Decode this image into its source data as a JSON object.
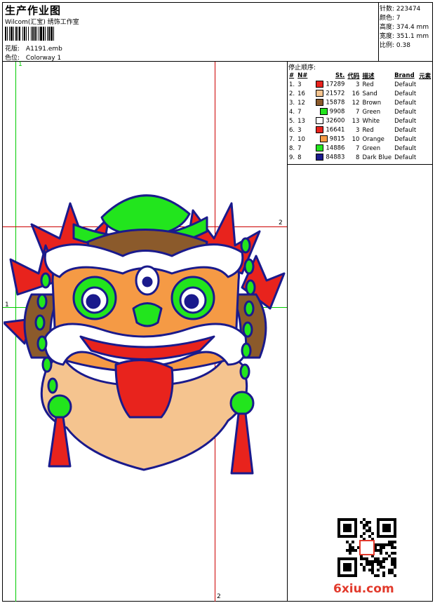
{
  "header": {
    "title": "生产作业图",
    "company": "Wilcom(汇宝) 绣饰工作室",
    "design_label": "花版:",
    "design_file": "A1191.emb",
    "colorway_label": "色位:",
    "colorway": "Colorway 1"
  },
  "specs": [
    {
      "label": "针数:",
      "value": "223474"
    },
    {
      "label": "颜色:",
      "value": "7"
    },
    {
      "label": "高度:",
      "value": "374.4 mm"
    },
    {
      "label": "宽度:",
      "value": "351.1 mm"
    },
    {
      "label": "比例:",
      "value": "0.38"
    }
  ],
  "stop_sequence": {
    "title": "停止顺序:",
    "columns": [
      "#",
      "N#",
      "St.",
      "代码",
      "描述",
      "Brand",
      "元素"
    ],
    "rows": [
      {
        "idx": "1.",
        "n": "3",
        "color": "#e8231d",
        "st": "17289",
        "code": "3",
        "desc": "Red",
        "brand": "Default"
      },
      {
        "idx": "2.",
        "n": "16",
        "color": "#f5c48f",
        "st": "21572",
        "code": "16",
        "desc": "Sand",
        "brand": "Default"
      },
      {
        "idx": "3.",
        "n": "12",
        "color": "#8b5a2b",
        "st": "15878",
        "code": "12",
        "desc": "Brown",
        "brand": "Default"
      },
      {
        "idx": "4.",
        "n": "7",
        "color": "#22e51d",
        "st": "9908",
        "code": "7",
        "desc": "Green",
        "brand": "Default"
      },
      {
        "idx": "5.",
        "n": "13",
        "color": "#ffffff",
        "st": "32600",
        "code": "13",
        "desc": "White",
        "brand": "Default"
      },
      {
        "idx": "6.",
        "n": "3",
        "color": "#e8231d",
        "st": "16641",
        "code": "3",
        "desc": "Red",
        "brand": "Default"
      },
      {
        "idx": "7.",
        "n": "10",
        "color": "#f59a45",
        "st": "9815",
        "code": "10",
        "desc": "Orange",
        "brand": "Default"
      },
      {
        "idx": "8.",
        "n": "7",
        "color": "#22e51d",
        "st": "14886",
        "code": "7",
        "desc": "Green",
        "brand": "Default"
      },
      {
        "idx": "9.",
        "n": "8",
        "color": "#1a1a8c",
        "st": "84883",
        "code": "8",
        "desc": "Dark Blue",
        "brand": "Default"
      }
    ]
  },
  "guides": {
    "v1": "1",
    "v2": "2",
    "h1": "1",
    "h2": "2"
  },
  "watermark": {
    "site": "6xiu.com"
  },
  "colors": {
    "guide_green": "#00cc00",
    "guide_red": "#cc0000",
    "site_red": "#e23a2c"
  }
}
